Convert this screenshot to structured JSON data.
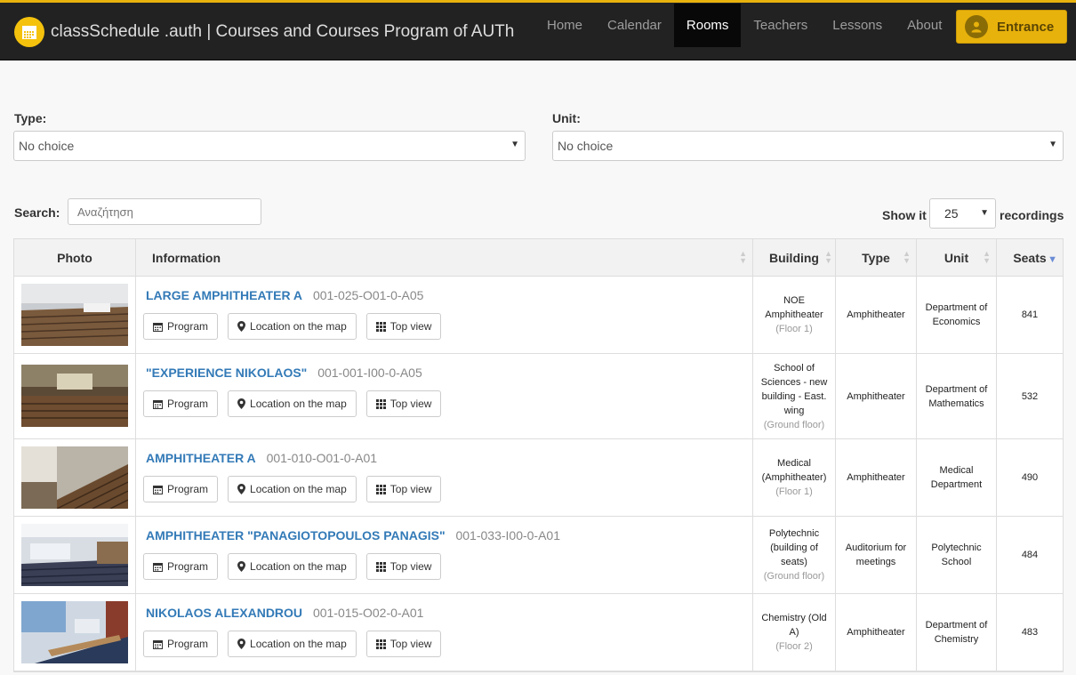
{
  "header": {
    "brand": "classSchedule .auth | Courses and Courses Program of AUTh",
    "nav": [
      "Home",
      "Calendar",
      "Rooms",
      "Teachers",
      "Lessons",
      "About"
    ],
    "active_nav": "Rooms",
    "entrance_label": "Entrance"
  },
  "filters": {
    "type_label": "Type:",
    "type_value": "No choice",
    "unit_label": "Unit:",
    "unit_value": "No choice"
  },
  "search": {
    "label": "Search:",
    "placeholder": "Αναζήτηση"
  },
  "length": {
    "show_label": "Show it",
    "value": "25",
    "recordings_label": "recordings"
  },
  "table": {
    "headers": {
      "photo": "Photo",
      "info": "Information",
      "building": "Building",
      "type": "Type",
      "unit": "Unit",
      "seats": "Seats"
    },
    "buttons": {
      "program": "Program",
      "map": "Location on the map",
      "top": "Top view"
    },
    "rows": [
      {
        "name": "LARGE AMPHITHEATER A",
        "code": "001-025-O01-0-A05",
        "building": "NOE Amphitheater",
        "floor": "(Floor 1)",
        "type": "Amphitheater",
        "unit": "Department of Economics",
        "seats": "841"
      },
      {
        "name": "\"EXPERIENCE NIKOLAOS\"",
        "code": "001-001-I00-0-A05",
        "building": "School of Sciences - new building - East. wing",
        "floor": "(Ground floor)",
        "type": "Amphitheater",
        "unit": "Department of Mathematics",
        "seats": "532"
      },
      {
        "name": "AMPHITHEATER A",
        "code": "001-010-O01-0-A01",
        "building": "Medical (Amphitheater)",
        "floor": "(Floor 1)",
        "type": "Amphitheater",
        "unit": "Medical Department",
        "seats": "490"
      },
      {
        "name": "AMPHITHEATER \"PANAGIOTOPOULOS PANAGIS\"",
        "code": "001-033-I00-0-A01",
        "building": "Polytechnic (building of seats)",
        "floor": "(Ground floor)",
        "type": "Auditorium for meetings",
        "unit": "Polytechnic School",
        "seats": "484"
      },
      {
        "name": "NIKOLAOS ALEXANDROU",
        "code": "001-015-O02-0-A01",
        "building": "Chemistry (Old A)",
        "floor": "(Floor 2)",
        "type": "Amphitheater",
        "unit": "Department of Chemistry",
        "seats": "483"
      }
    ]
  },
  "colors": {
    "accent": "#e8b20c",
    "navbar": "#222222",
    "link": "#337ab7"
  }
}
